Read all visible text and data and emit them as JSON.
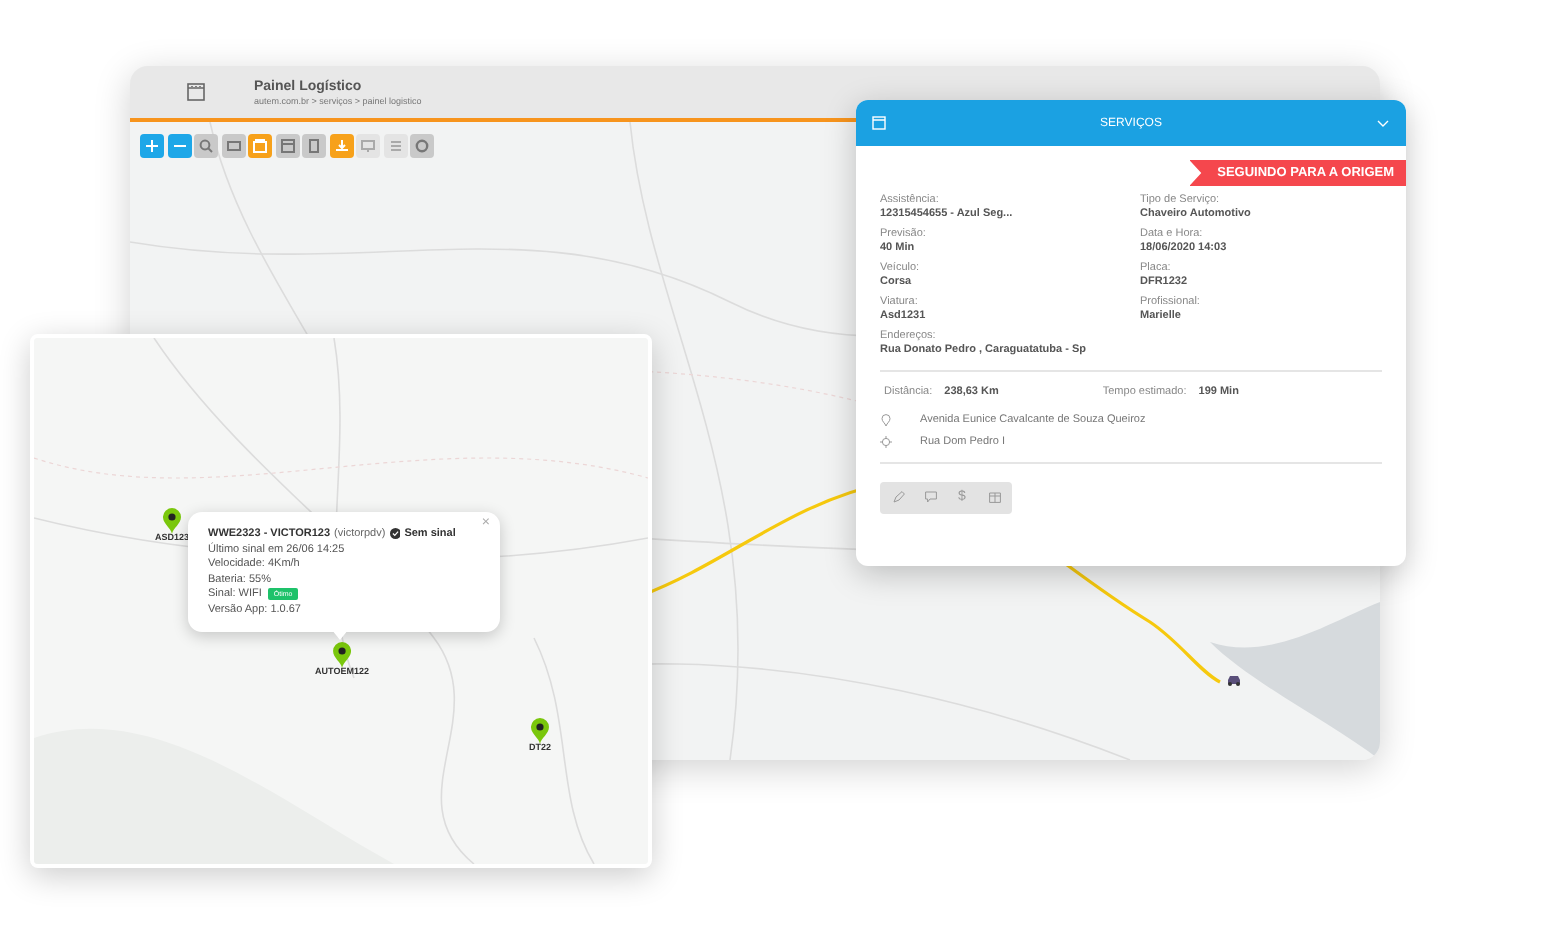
{
  "window": {
    "title": "Painel Logístico",
    "breadcrumb": "autem.com.br > serviços > painel logistico"
  },
  "toolbar": [
    {
      "kind": "action",
      "selected": false,
      "disabled": false
    },
    {
      "kind": "action",
      "selected": false,
      "disabled": false
    },
    {
      "kind": "tool",
      "selected": false,
      "disabled": false
    },
    {
      "kind": "tool",
      "selected": false,
      "disabled": false
    },
    {
      "kind": "tool",
      "selected": true,
      "disabled": false
    },
    {
      "kind": "tool",
      "selected": false,
      "disabled": false
    },
    {
      "kind": "tool",
      "selected": false,
      "disabled": false
    },
    {
      "kind": "tool",
      "selected": true,
      "disabled": false
    },
    {
      "kind": "tool",
      "selected": false,
      "disabled": true
    },
    {
      "kind": "tool",
      "selected": false,
      "disabled": true
    },
    {
      "kind": "tool",
      "selected": false,
      "disabled": false
    }
  ],
  "service_panel": {
    "title": "SERVIÇOS",
    "status": "SEGUINDO PARA A ORIGEM",
    "fields": [
      {
        "label": "Assistência:",
        "value": "12315454655 - Azul Seg..."
      },
      {
        "label": "Tipo de Serviço:",
        "value": "Chaveiro Automotivo"
      },
      {
        "label": "Previsão:",
        "value": "40 Min"
      },
      {
        "label": "Data e Hora:",
        "value": "18/06/2020 14:03"
      },
      {
        "label": "Veículo:",
        "value": "Corsa"
      },
      {
        "label": "Placa:",
        "value": "DFR1232"
      },
      {
        "label": "Viatura:",
        "value": "Asd1231"
      },
      {
        "label": "Profissional:",
        "value": "Marielle"
      }
    ],
    "address": {
      "label": "Endereços:",
      "value": "Rua Donato Pedro , Caraguatatuba - Sp"
    },
    "distance": {
      "label": "Distância:",
      "value": "238,63 Km"
    },
    "time": {
      "label": "Tempo estimado:",
      "value": "199 Min"
    },
    "route": [
      {
        "kind": "origin",
        "text": "Avenida Eunice Cavalcante de Souza Queiroz"
      },
      {
        "kind": "destination",
        "text": "Rua Dom Pedro I"
      }
    ],
    "actions": [
      {
        "kind": "edit"
      },
      {
        "kind": "chat"
      },
      {
        "kind": "glyph",
        "glyph": "$"
      },
      {
        "kind": "package"
      }
    ]
  },
  "vehicle_map": {
    "pins": [
      {
        "label": "ASD123"
      },
      {
        "label": "AUTOEM122"
      },
      {
        "label": "DT22"
      }
    ],
    "popup": {
      "title": "WWE2323 - VICTOR123",
      "user": "(victorpdv)",
      "status": "Sem sinal",
      "close": "×",
      "lines": [
        {
          "kind": "text",
          "text": "Último sinal em 26/06 14:25"
        },
        {
          "kind": "text",
          "text": "Velocidade: 4Km/h"
        },
        {
          "kind": "text",
          "text": "Bateria: 55%"
        },
        {
          "kind": "signal",
          "text": "Sinal: WIFI",
          "badge": "Ótimo"
        },
        {
          "kind": "text",
          "text": "Versão App: 1.0.67"
        }
      ]
    }
  }
}
